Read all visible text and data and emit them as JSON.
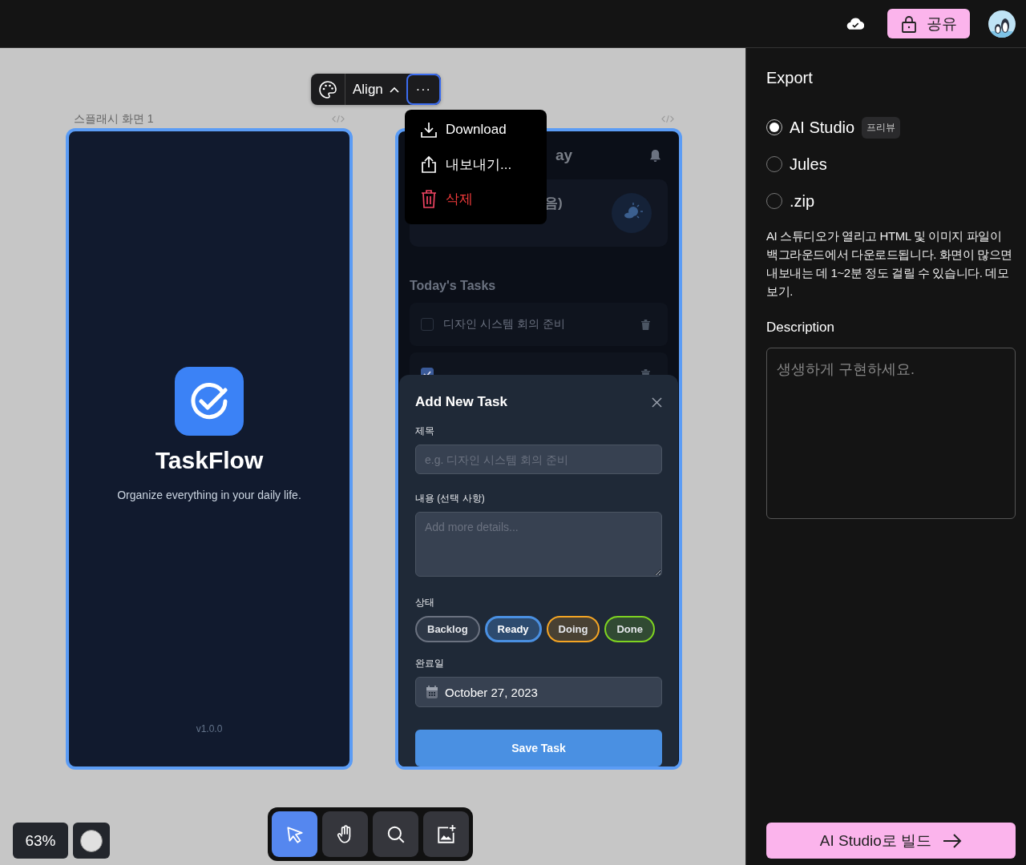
{
  "top_bar": {
    "share_button": "공유"
  },
  "canvas": {
    "toolbar": {
      "align_button": "Align",
      "more_button": "···"
    },
    "more_menu": [
      {
        "label": "Download",
        "kind": "download"
      },
      {
        "label": "내보내기...",
        "kind": "export"
      },
      {
        "label": "삭제",
        "kind": "delete"
      }
    ],
    "splash_frame": {
      "label": "스플래시 화면 1",
      "title": "TaskFlow",
      "subtitle": "Organize everything in your daily life.",
      "version": "v1.0.0"
    },
    "home_frame": {
      "heading_fragment": "ay",
      "weather_fragment": "음)",
      "section_title": "Today's Tasks",
      "tasks": [
        {
          "title": "디자인 시스템 회의 준비",
          "checked": false
        },
        {
          "checked": true
        }
      ],
      "modal": {
        "title": "Add New Task",
        "title_label": "제목",
        "title_placeholder": "e.g. 디자인 시스템 회의 준비",
        "details_label": "내용 (선택 사항)",
        "details_placeholder": "Add more details...",
        "status_label": "상태",
        "statuses": [
          {
            "label": "Backlog",
            "color": "#6b7280",
            "selected": false
          },
          {
            "label": "Ready",
            "color": "#4a90e2",
            "selected": true
          },
          {
            "label": "Doing",
            "color": "#f5a524",
            "selected": false
          },
          {
            "label": "Done",
            "color": "#7ed321",
            "selected": false
          }
        ],
        "due_label": "완료일",
        "due_value": "October 27, 2023",
        "save_button": "Save Task"
      }
    },
    "zoom": "63%",
    "tools": [
      {
        "kind": "pointer",
        "selected": true
      },
      {
        "kind": "hand",
        "selected": false
      },
      {
        "kind": "search",
        "selected": false
      },
      {
        "kind": "image",
        "selected": false
      }
    ]
  },
  "export_panel": {
    "title": "Export",
    "options": [
      {
        "label": "AI Studio",
        "badge": "프리뷰",
        "selected": true
      },
      {
        "label": "Jules",
        "selected": false
      },
      {
        "label": ".zip",
        "selected": false
      }
    ],
    "note": "AI 스튜디오가 열리고 HTML 및 이미지 파일이 백그라운드에서 다운로드됩니다. 화면이 많으면 내보내는 데 1~2분 정도 걸릴 수 있습니다. 데모 보기.",
    "description_label": "Description",
    "description_placeholder": "생생하게 구현하세요.",
    "build_button": "AI Studio로 빌드"
  }
}
